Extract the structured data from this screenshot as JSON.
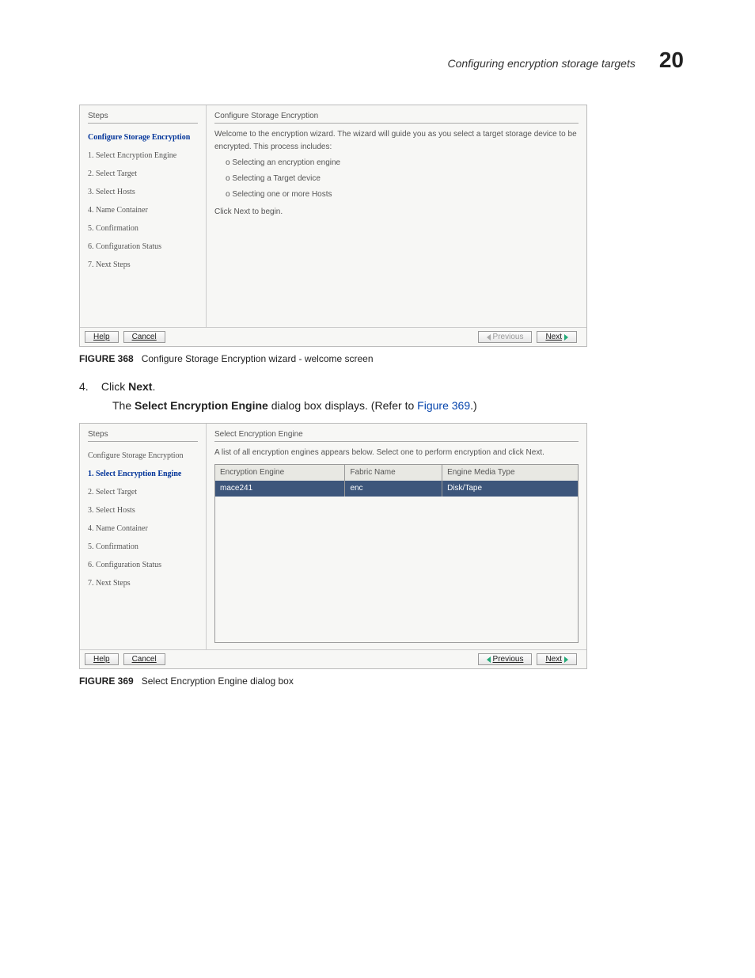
{
  "header": {
    "title": "Configuring encryption storage targets",
    "chapter": "20"
  },
  "wizard1": {
    "steps_label": "Steps",
    "content_title": "Configure Storage Encryption",
    "steps": [
      "Configure Storage Encryption",
      "1. Select Encryption Engine",
      "2. Select Target",
      "3. Select Hosts",
      "4. Name Container",
      "5. Confirmation",
      "6. Configuration Status",
      "7. Next Steps"
    ],
    "current_step_index": 0,
    "welcome_text": "Welcome to the encryption wizard. The wizard will guide you as you select a target storage device to be encrypted. This process includes:",
    "bullets": [
      "o Selecting an encryption engine",
      "o Selecting a Target device",
      "o Selecting one or more Hosts"
    ],
    "click_next": "Click Next to begin.",
    "buttons": {
      "help": "Help",
      "cancel": "Cancel",
      "previous": "Previous",
      "next": "Next"
    }
  },
  "figure368": {
    "label": "FIGURE 368",
    "caption": "Configure Storage Encryption wizard - welcome screen"
  },
  "instruction": {
    "num": "4.",
    "text_pre": "Click ",
    "bold": "Next",
    "text_post": "."
  },
  "subtext": {
    "pre": "The ",
    "bold": "Select Encryption Engine",
    "mid": " dialog box displays. (Refer to ",
    "link": "Figure 369",
    "post": ".)"
  },
  "wizard2": {
    "steps_label": "Steps",
    "content_title": "Select Encryption Engine",
    "steps": [
      "Configure Storage Encryption",
      "1. Select Encryption Engine",
      "2. Select Target",
      "3. Select Hosts",
      "4. Name Container",
      "5. Confirmation",
      "6. Configuration Status",
      "7. Next Steps"
    ],
    "current_step_index": 1,
    "instruction_text": "A list of all encryption engines appears below. Select one to perform encryption and click Next.",
    "table_headers": [
      "Encryption Engine",
      "Fabric Name",
      "Engine Media Type"
    ],
    "table_row": [
      "mace241",
      "enc",
      "Disk/Tape"
    ],
    "buttons": {
      "help": "Help",
      "cancel": "Cancel",
      "previous": "Previous",
      "next": "Next"
    }
  },
  "figure369": {
    "label": "FIGURE 369",
    "caption": "Select Encryption Engine dialog box"
  }
}
